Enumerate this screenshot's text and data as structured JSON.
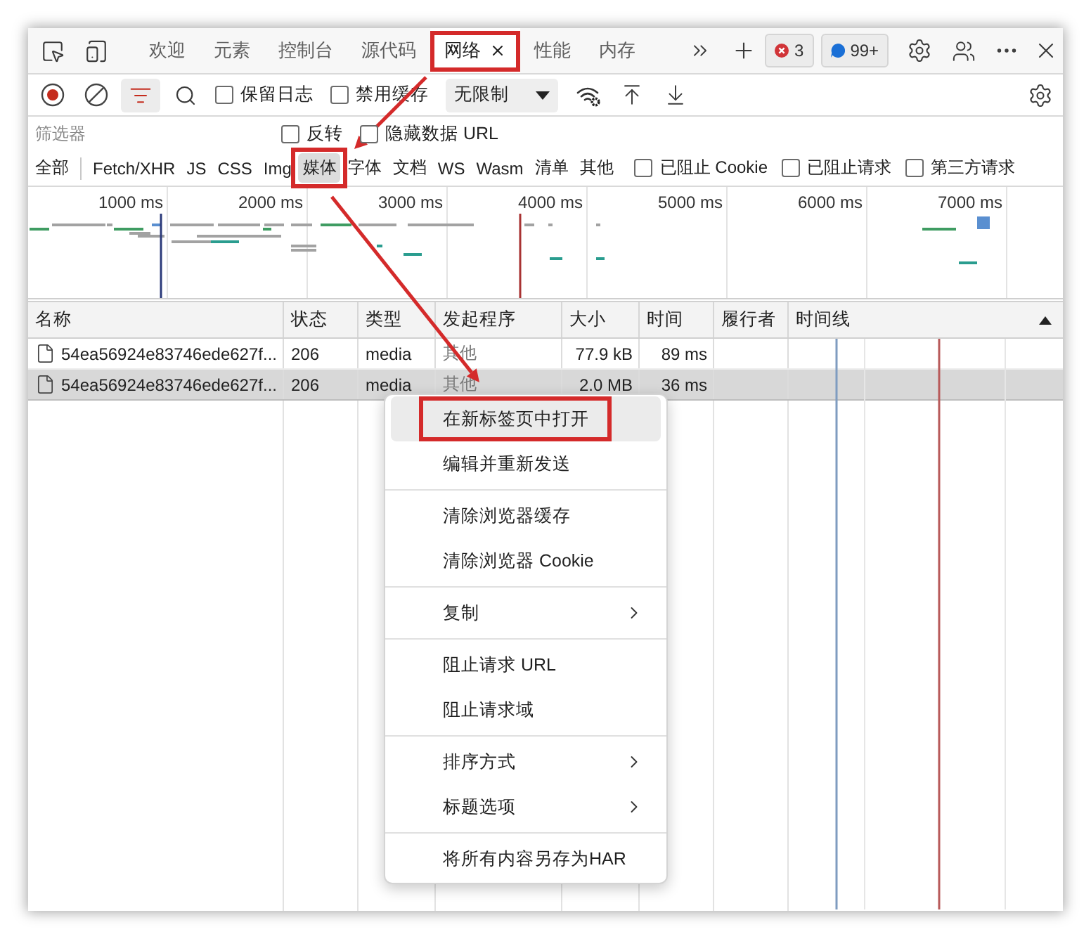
{
  "tabs": [
    {
      "label": "欢迎",
      "selected": false,
      "highlighted": false
    },
    {
      "label": "元素",
      "selected": false,
      "highlighted": false
    },
    {
      "label": "控制台",
      "selected": false,
      "highlighted": false
    },
    {
      "label": "源代码",
      "selected": false,
      "highlighted": false
    },
    {
      "label": "网络",
      "selected": true,
      "highlighted": true
    },
    {
      "label": "性能",
      "selected": false,
      "highlighted": false
    },
    {
      "label": "内存",
      "selected": false,
      "highlighted": false
    }
  ],
  "badges": [
    {
      "kind": "error",
      "count": "3"
    },
    {
      "kind": "message",
      "count": "99+"
    }
  ],
  "toolbar": {
    "recording": true,
    "filter_open": true,
    "options": [
      {
        "label": "保留日志",
        "checked": false
      },
      {
        "label": "禁用缓存",
        "checked": false
      }
    ],
    "throttling": "无限制"
  },
  "filter_bar": {
    "placeholder": "筛选器",
    "options": [
      {
        "label": "反转",
        "checked": false
      },
      {
        "label": "隐藏数据 URL",
        "checked": false
      }
    ]
  },
  "type_filters": [
    {
      "label": "全部",
      "selected": false,
      "highlighted": false
    },
    {
      "label": "Fetch/XHR",
      "selected": false,
      "highlighted": false
    },
    {
      "label": "JS",
      "selected": false,
      "highlighted": false
    },
    {
      "label": "CSS",
      "selected": false,
      "highlighted": false
    },
    {
      "label": "Img",
      "selected": false,
      "highlighted": false
    },
    {
      "label": "媒体",
      "selected": true,
      "highlighted": true
    },
    {
      "label": "字体",
      "selected": false,
      "highlighted": false
    },
    {
      "label": "文档",
      "selected": false,
      "highlighted": false
    },
    {
      "label": "WS",
      "selected": false,
      "highlighted": false
    },
    {
      "label": "Wasm",
      "selected": false,
      "highlighted": false
    },
    {
      "label": "清单",
      "selected": false,
      "highlighted": false
    },
    {
      "label": "其他",
      "selected": false,
      "highlighted": false
    }
  ],
  "blocked_options": [
    {
      "label": "已阻止 Cookie",
      "checked": false
    },
    {
      "label": "已阻止请求",
      "checked": false
    },
    {
      "label": "第三方请求",
      "checked": false
    }
  ],
  "overview": {
    "ticks": [
      "1000 ms",
      "2000 ms",
      "3000 ms",
      "4000 ms",
      "5000 ms",
      "6000 ms",
      "7000 ms"
    ]
  },
  "table": {
    "columns": [
      {
        "label": "名称",
        "sorted": false
      },
      {
        "label": "状态",
        "sorted": false
      },
      {
        "label": "类型",
        "sorted": false
      },
      {
        "label": "发起程序",
        "sorted": false
      },
      {
        "label": "大小",
        "sorted": false
      },
      {
        "label": "时间",
        "sorted": false
      },
      {
        "label": "履行者",
        "sorted": false
      },
      {
        "label": "时间线",
        "sorted": true
      }
    ],
    "rows": [
      {
        "name": "54ea56924e83746ede627f...",
        "status": "206",
        "type": "media",
        "initiator": "其他",
        "size": "77.9 kB",
        "time": "89 ms",
        "selected": false
      },
      {
        "name": "54ea56924e83746ede627f...",
        "status": "206",
        "type": "media",
        "initiator": "其他",
        "size": "2.0 MB",
        "time": "36 ms",
        "selected": true
      }
    ]
  },
  "context_menu": {
    "groups": [
      {
        "items": [
          {
            "label": "在新标签页中打开",
            "hovered": true,
            "highlighted": true,
            "submenu": false
          },
          {
            "label": "编辑并重新发送",
            "hovered": false,
            "highlighted": false,
            "submenu": false
          }
        ]
      },
      {
        "items": [
          {
            "label": "清除浏览器缓存",
            "hovered": false,
            "highlighted": false,
            "submenu": false
          },
          {
            "label": "清除浏览器 Cookie",
            "hovered": false,
            "highlighted": false,
            "submenu": false
          }
        ]
      },
      {
        "items": [
          {
            "label": "复制",
            "hovered": false,
            "highlighted": false,
            "submenu": true
          }
        ]
      },
      {
        "items": [
          {
            "label": "阻止请求 URL",
            "hovered": false,
            "highlighted": false,
            "submenu": false
          },
          {
            "label": "阻止请求域",
            "hovered": false,
            "highlighted": false,
            "submenu": false
          }
        ]
      },
      {
        "items": [
          {
            "label": "排序方式",
            "hovered": false,
            "highlighted": false,
            "submenu": true
          },
          {
            "label": "标题选项",
            "hovered": false,
            "highlighted": false,
            "submenu": true
          }
        ]
      },
      {
        "items": [
          {
            "label": "将所有内容另存为HAR",
            "hovered": false,
            "highlighted": false,
            "submenu": false
          }
        ]
      }
    ]
  }
}
